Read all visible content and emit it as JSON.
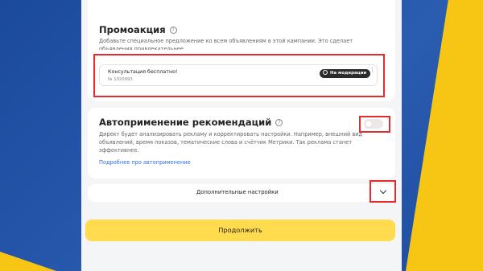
{
  "promo": {
    "title": "Промоакция",
    "help_glyph": "?",
    "description_line1": "Добавьте специальное предложение ко всем объявлениям в этой кампании. Это сделает",
    "description_line2": "объявления привлекательнее.",
    "ad": {
      "title": "Консультация бесплатно!",
      "number": "№ 1020993",
      "status": "На модерации",
      "menu_glyph": "⋮"
    }
  },
  "auto": {
    "title": "Автоприменение рекомендаций",
    "help_glyph": "?",
    "toggle_on": false,
    "description_line1": "Директ будет анализировать рекламу и корректировать настройки. Например, внешний вид",
    "description_line2": "объявлений, время показов, тематические слова и счётчик Метрики. Так реклама станет",
    "description_line3": "эффективнее.",
    "link": "Подробнее про автоприменение"
  },
  "extra": {
    "label": "Дополнительные настройки"
  },
  "continue_label": "Продолжить",
  "colors": {
    "highlight": "#e52b2b",
    "cta": "#ffdb4d",
    "link": "#2f6fe0",
    "frame_blue": "#1f4fa0",
    "frame_yellow": "#f7c615"
  }
}
